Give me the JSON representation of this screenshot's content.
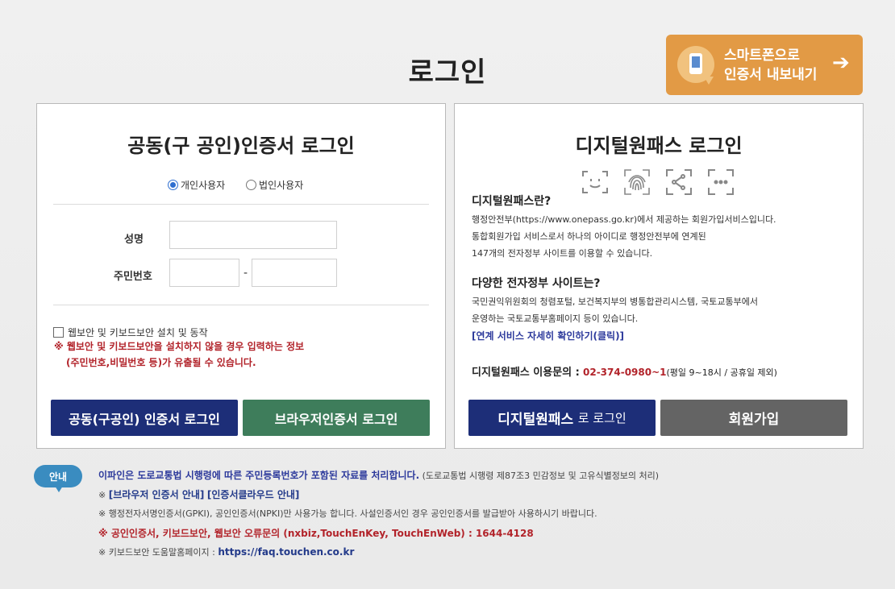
{
  "page": {
    "title": "로그인"
  },
  "export": {
    "line1": "스마트폰으로",
    "line2": "인증서 내보내기",
    "arrow": "➔"
  },
  "left": {
    "title": "공동(구 공인)인증서 로그인",
    "radio_personal": "개인사용자",
    "radio_corp": "법인사용자",
    "name_label": "성명",
    "rrn_label": "주민번호",
    "dash": "-",
    "checkbox_label": "웹보안 및 키보드보안 설치 및 동작",
    "warn1": "※ 웹보안 및 키보드보안을 설치하지 않을 경우 입력하는 정보",
    "warn2": "(주민번호,비밀번호 등)가 유출될 수 있습니다.",
    "btn_cert": "공동(구공인) 인증서 로그인",
    "btn_browser": "브라우저인증서 로그인"
  },
  "right": {
    "title": "디지털원패스 로그인",
    "q1": "디지털원패스란?",
    "a1_l1": "행정안전부(https://www.onepass.go.kr)에서 제공하는 회원가입서비스입니다.",
    "a1_l2": "통합회원가입 서비스로서 하나의 아이디로 행정안전부에 연계된",
    "a1_l3": "147개의 전자정부 사이트를 이용할 수 있습니다.",
    "q2": "다양한 전자정부 사이트는?",
    "a2_l1": "국민권익위원회의 청렴포털, 보건복지부의 병통합관리시스템, 국토교통부에서",
    "a2_l2": "운영하는 국토교통부홈페이지 등이 있습니다.",
    "link": "[연계 서비스 자세히 확인하기(클릭)]",
    "contact_label": "디지털원패스 이용문의 :",
    "contact_num": "02-374-0980~1",
    "contact_note": "(평일 9~18시 / 공휴일 제외)",
    "btn_login_strong": "디지털원패스",
    "btn_login_rest": "로 로그인",
    "btn_join": "회원가입"
  },
  "notice": {
    "badge": "안내",
    "l1_bold": "이파인은 도로교통법 시행령에 따른 주민등록번호가 포함된 자료를 처리합니다.",
    "l1_rest": "(도로교통법 시행령 제87조3 민감정보 및 고유식별정보의 처리)",
    "l2_prefix": "※",
    "l2_link1": "[브라우저 인증서 안내]",
    "l2_link2": "[인증서클라우드 안내]",
    "l3": "※ 행정전자서명인증서(GPKI), 공인인증서(NPKI)만 사용가능 합니다. 사설인증서인 경우 공인인증서를 발급받아 사용하시기 바랍니다.",
    "l4": "※ 공인인증서, 키보드보안, 웹보안 오류문의 (nxbiz,TouchEnKey, TouchEnWeb) : 1644-4128",
    "l5_prefix": "※ 키보드보안 도움말홈페이지 :",
    "l5_link": "https://faq.touchen.co.kr"
  },
  "icons": [
    "face-id-icon",
    "fingerprint-icon",
    "pattern-icon",
    "pin-icon",
    "smartphone-icon",
    "arrow-right-icon"
  ],
  "colors": {
    "navy": "#1d2e78",
    "green": "#3e7d5b",
    "gray": "#646464",
    "orange": "#e29a45",
    "red": "#b2232a",
    "badge": "#3a8cc0"
  }
}
